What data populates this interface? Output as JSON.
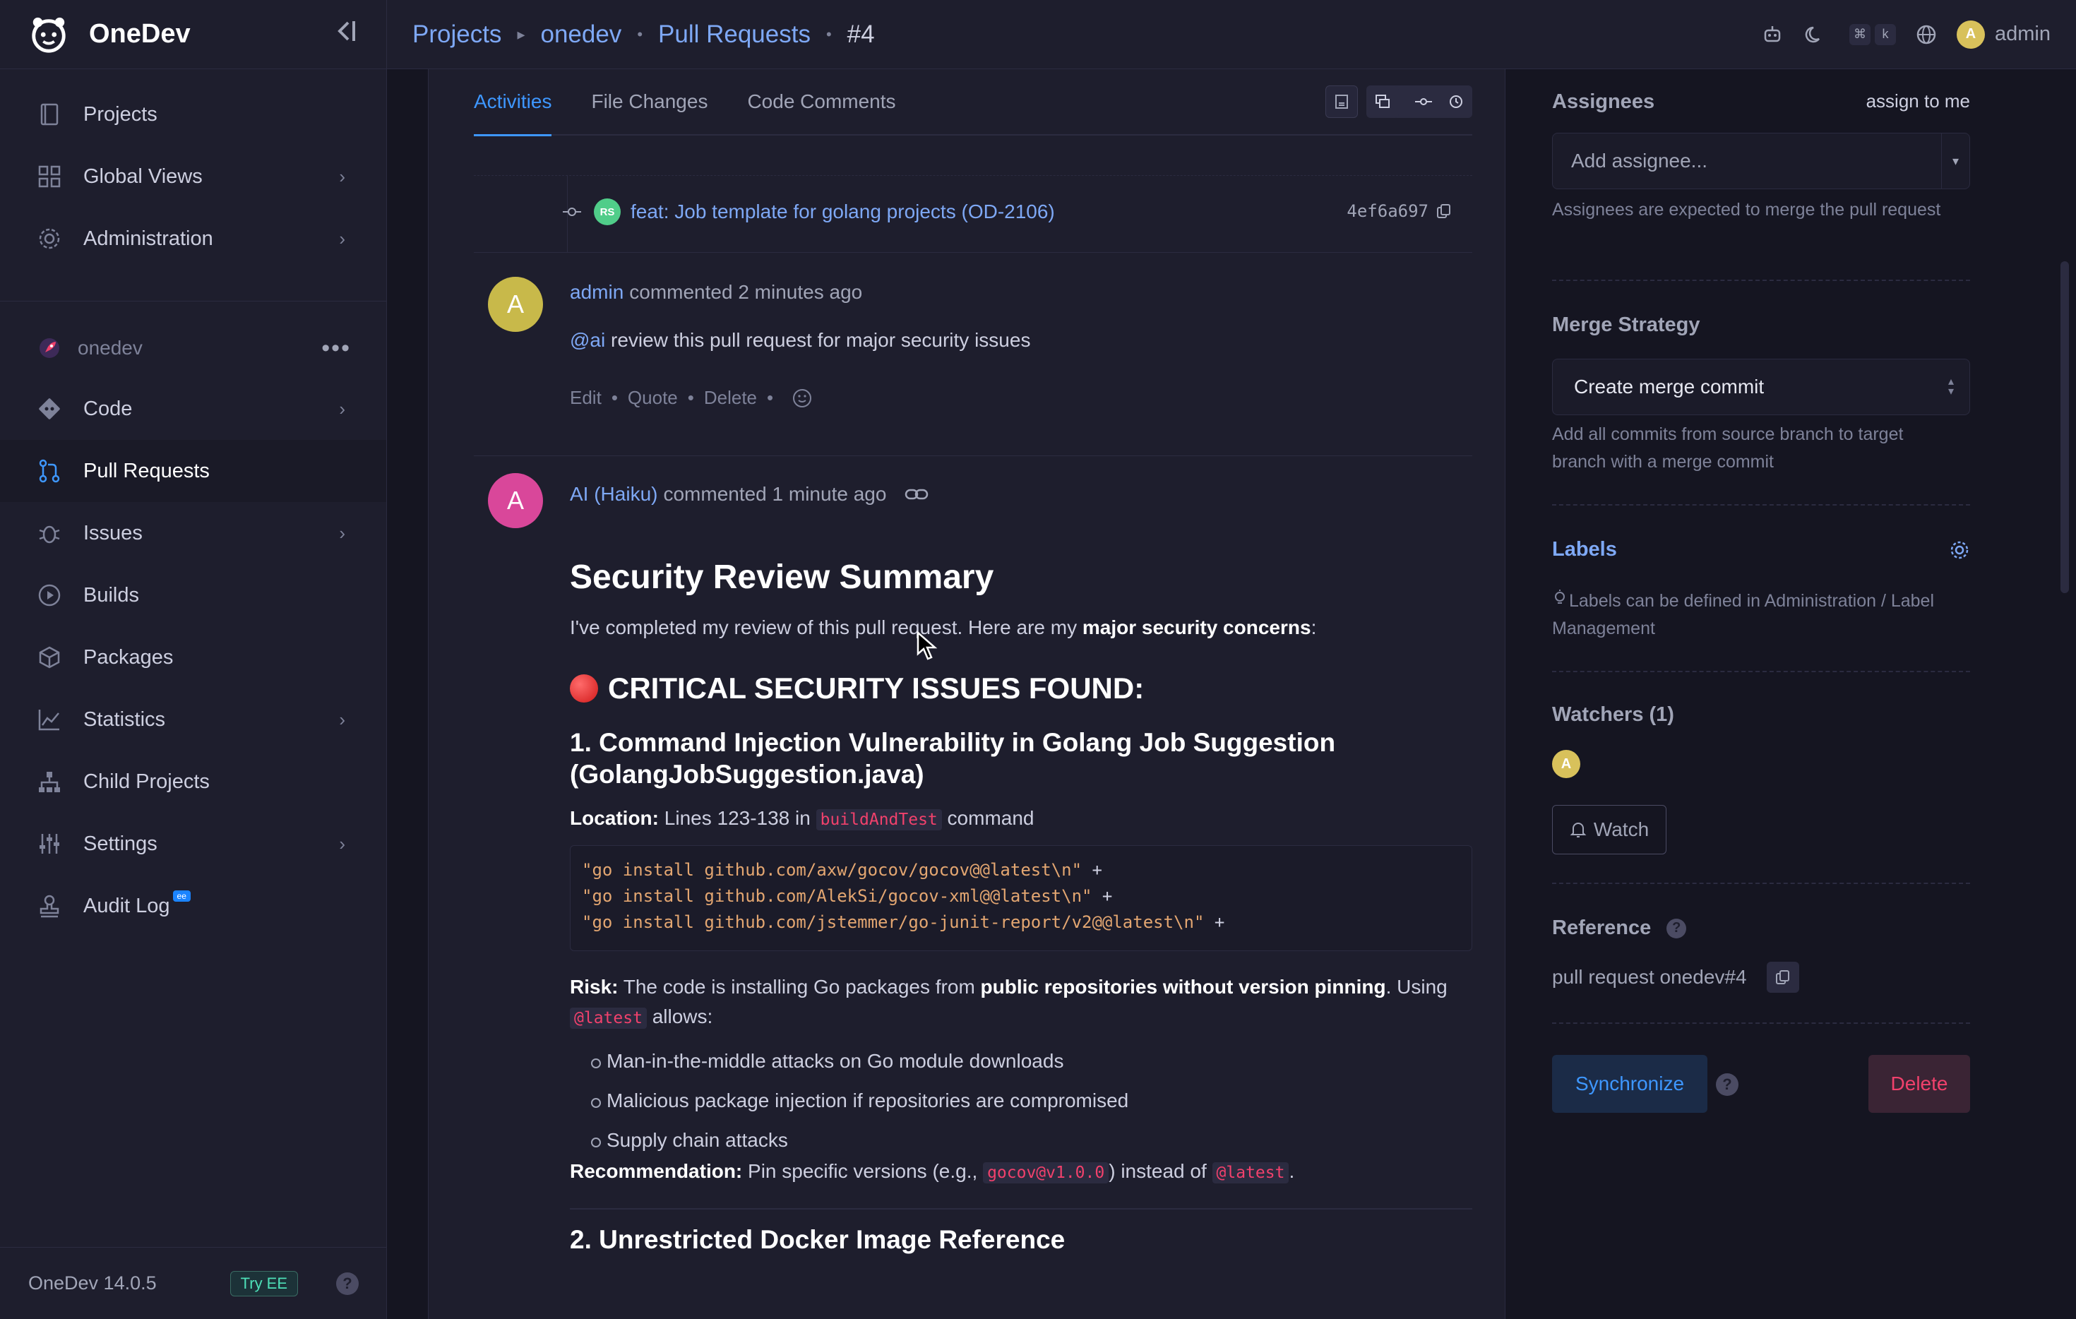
{
  "app": {
    "name": "OneDev",
    "version": "OneDev 14.0.5",
    "try_ee": "Try EE",
    "ee_badge": "ee"
  },
  "sidebar": {
    "top_items": [
      {
        "label": "Projects",
        "icon": "projects-icon"
      },
      {
        "label": "Global Views",
        "icon": "grid-icon",
        "chevron": true
      },
      {
        "label": "Administration",
        "icon": "gear-icon",
        "chevron": true
      }
    ],
    "project": {
      "name": "onedev",
      "icon": "rocket-icon"
    },
    "project_items": [
      {
        "label": "Code",
        "icon": "git-icon",
        "chevron": true
      },
      {
        "label": "Pull Requests",
        "icon": "pull-request-icon",
        "active": true
      },
      {
        "label": "Issues",
        "icon": "bug-icon",
        "chevron": true
      },
      {
        "label": "Builds",
        "icon": "play-icon"
      },
      {
        "label": "Packages",
        "icon": "package-icon"
      },
      {
        "label": "Statistics",
        "icon": "chart-icon",
        "chevron": true
      },
      {
        "label": "Child Projects",
        "icon": "hierarchy-icon"
      },
      {
        "label": "Settings",
        "icon": "sliders-icon",
        "chevron": true
      },
      {
        "label": "Audit Log",
        "icon": "stamp-icon"
      }
    ]
  },
  "breadcrumb": {
    "projects": "Projects",
    "project": "onedev",
    "section": "Pull Requests",
    "current": "#4"
  },
  "topbar": {
    "kbd1": "⌘",
    "kbd2": "k",
    "user": "admin",
    "user_initial": "A"
  },
  "tabs": [
    "Activities",
    "File Changes",
    "Code Comments"
  ],
  "commit": {
    "avatar": "RS",
    "message": "feat: Job template for golang projects (OD-2106)",
    "hash": "4ef6a697"
  },
  "comment1": {
    "initial": "A",
    "author": "admin",
    "meta": "commented 2 minutes ago",
    "mention": "@ai",
    "text": " review this pull request for major security issues",
    "actions": [
      "Edit",
      "Quote",
      "Delete"
    ]
  },
  "comment2": {
    "initial": "A",
    "author": "AI (Haiku)",
    "meta": "commented 1 minute ago",
    "title": "Security Review Summary",
    "intro_pre": "I've completed my review of this pull request. Here are my ",
    "intro_bold": "major security concerns",
    "intro_post": ":",
    "critical": "CRITICAL SECURITY ISSUES FOUND:",
    "issue1_title_l1": "1. Command Injection Vulnerability in Golang Job Suggestion",
    "issue1_title_l2": "(GolangJobSuggestion.java)",
    "location_label": "Location:",
    "location_text": " Lines 123-138 in ",
    "location_code": "buildAndTest",
    "location_post": " command",
    "code_lines": [
      {
        "str": "\"go install github.com/axw/gocov/gocov@@latest\\n\"",
        "op": " +"
      },
      {
        "str": "\"go install github.com/AlekSi/gocov-xml@@latest\\n\"",
        "op": " +"
      },
      {
        "str": "\"go install github.com/jstemmer/go-junit-report/v2@@latest\\n\"",
        "op": " +"
      }
    ],
    "risk_label": "Risk:",
    "risk_pre": " The code is installing Go packages from ",
    "risk_bold": "public repositories without version pinning",
    "risk_post": ". Using",
    "risk_code": "@latest",
    "risk_post2": " allows:",
    "bullets": [
      "Man-in-the-middle attacks on Go module downloads",
      "Malicious package injection if repositories are compromised",
      "Supply chain attacks"
    ],
    "rec_label": "Recommendation:",
    "rec_pre": " Pin specific versions (e.g., ",
    "rec_code1": "gocov@v1.0.0",
    "rec_mid": ") instead of ",
    "rec_code2": "@latest",
    "rec_post": ".",
    "issue2_title": "2. Unrestricted Docker Image Reference"
  },
  "right": {
    "assignees_title": "Assignees",
    "assign_to_me": "assign to me",
    "assignee_placeholder": "Add assignee...",
    "assignees_note": "Assignees are expected to merge the pull request",
    "merge_title": "Merge Strategy",
    "merge_value": "Create merge commit",
    "merge_note": "Add all commits from source branch to target branch with a merge commit",
    "labels_title": "Labels",
    "labels_note": "Labels can be defined in Administration / Label Management",
    "watchers_title": "Watchers (1)",
    "watcher_initial": "A",
    "watch_button": "Watch",
    "reference_title": "Reference",
    "reference_value": "pull request onedev#4",
    "sync_button": "Synchronize",
    "delete_button": "Delete"
  },
  "colors": {
    "accent": "#3e97ff",
    "link": "#7ea8f5",
    "danger": "#f1416c",
    "bg": "#1e1e2d"
  }
}
